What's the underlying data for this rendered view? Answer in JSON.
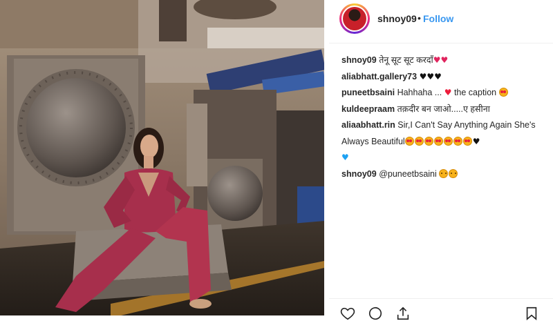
{
  "header": {
    "username": "shnoy09",
    "separator": "•",
    "follow_label": "Follow"
  },
  "comments": [
    {
      "user": "shnoy09",
      "text": "तेनू सूट सूट करदाँ",
      "emoji": [
        "broken-heart",
        "broken-heart"
      ]
    },
    {
      "user": "aliabhatt.gallery73",
      "text": "",
      "emoji": [
        "black-heart",
        "black-heart",
        "black-heart"
      ]
    },
    {
      "user": "puneetbsaini",
      "text": "Hahhaha ...",
      "text2": "the caption",
      "emoji": [
        "red-heart",
        "star-struck-face"
      ]
    },
    {
      "user": "kuldeepraam",
      "text": "तक़दीर बन जाओ.....ए हसीना",
      "emoji": []
    },
    {
      "user": "aliaabhatt.rin",
      "text": "Sir,I Can't Say Anything Again She's Always Beautiful",
      "emoji": [
        "star-struck-face",
        "star-struck-face",
        "star-struck-face",
        "star-struck-face",
        "star-struck-face",
        "star-struck-face",
        "star-struck-face",
        "black-heart",
        "blue-heart"
      ]
    },
    {
      "user": "shnoy09",
      "text": "@puneetbsaini",
      "emoji": [
        "yum-face",
        "yum-face"
      ]
    }
  ],
  "actions": {
    "icons": [
      "heart-icon",
      "comment-icon",
      "share-icon",
      "bookmark-icon"
    ]
  },
  "colors": {
    "follow": "#3897f0",
    "outfit": "#a72f4c",
    "heart_red": "#ed1c3b"
  }
}
